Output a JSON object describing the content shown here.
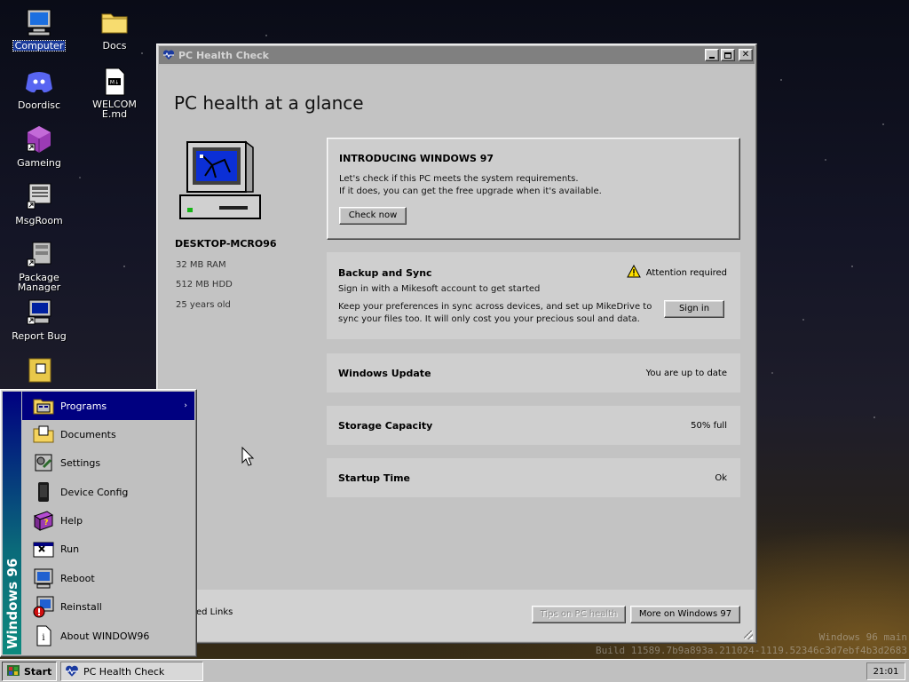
{
  "desktop": {
    "icons": [
      {
        "label": "Computer",
        "icon": "computer-icon"
      },
      {
        "label": "Docs",
        "icon": "folder-icon"
      },
      {
        "label": "Doordisc",
        "icon": "doordisc-icon"
      },
      {
        "label": "WELCOME.md",
        "icon": "markdown-file-icon"
      },
      {
        "label": "Gameing",
        "icon": "game-cube-icon"
      },
      {
        "label": "MsgRoom",
        "icon": "msgroom-icon"
      },
      {
        "label": "Package Manager",
        "icon": "package-manager-icon"
      },
      {
        "label": "Report Bug",
        "icon": "report-bug-icon"
      }
    ]
  },
  "window": {
    "title": "PC Health Check",
    "heading": "PC health at a glance",
    "device": {
      "name": "DESKTOP-MCRO96",
      "specs": [
        "32 MB RAM",
        "512 MB HDD",
        "25 years old"
      ]
    },
    "intro_card": {
      "title": "INTRODUCING WINDOWS 97",
      "line1": "Let's check if this PC meets the system requirements.",
      "line2": "If it does, you can get the free upgrade when it's available.",
      "button": "Check now"
    },
    "backup_card": {
      "title": "Backup and Sync",
      "status": "Attention required",
      "subtitle": "Sign in with a Mikesoft account to get started",
      "line1": "Keep your preferences in sync across devices, and set up MikeDrive to",
      "line2": "sync your files too. It will only cost you your precious soul and data.",
      "button": "Sign in"
    },
    "rows": [
      {
        "label": "Windows Update",
        "value": "You are up to date"
      },
      {
        "label": "Storage Capacity",
        "value": "50% full"
      },
      {
        "label": "Startup Time",
        "value": "Ok"
      }
    ],
    "footer": {
      "related": "ed Links",
      "tips_button": "Tips on PC health",
      "more_button": "More on Windows 97"
    }
  },
  "start_menu": {
    "banner": "Windows 96",
    "items": [
      {
        "label": "Programs",
        "icon": "programs-icon",
        "submenu": "›"
      },
      {
        "label": "Documents",
        "icon": "documents-icon"
      },
      {
        "label": "Settings",
        "icon": "settings-icon"
      },
      {
        "label": "Device Config",
        "icon": "device-config-icon"
      },
      {
        "label": "Help",
        "icon": "help-icon"
      },
      {
        "label": "Run",
        "icon": "run-icon"
      },
      {
        "label": "Reboot",
        "icon": "reboot-icon"
      },
      {
        "label": "Reinstall",
        "icon": "reinstall-icon"
      },
      {
        "label": "About WINDOW96",
        "icon": "about-icon"
      }
    ]
  },
  "taskbar": {
    "start_label": "Start",
    "task_label": "PC Health Check",
    "clock": "21:01"
  },
  "watermark": {
    "line1": "Windows 96 main",
    "line2": "Build 11589.7b9a893a.211024-1119.52346c3d7ebf4b3d2683"
  }
}
